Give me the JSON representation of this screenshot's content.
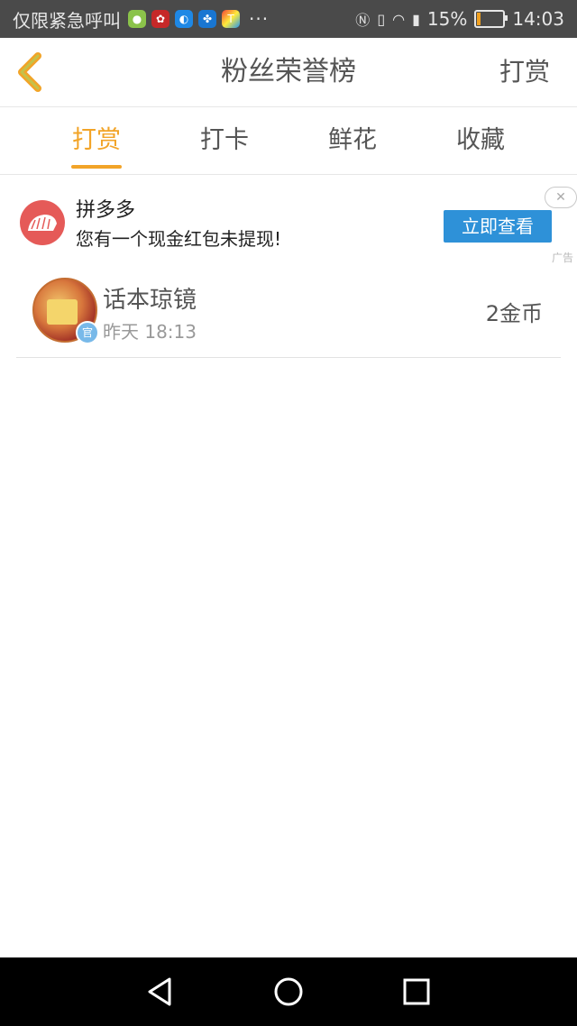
{
  "status_bar": {
    "carrier": "仅限紧急呼叫",
    "more": "···",
    "battery_percent": "15%",
    "time": "14:03",
    "notification_icons": [
      "wechat-icon",
      "huawei-icon",
      "app-blue-icon",
      "baidu-icon",
      "app-multicolor-icon"
    ]
  },
  "header": {
    "title": "粉丝荣誉榜",
    "action_label": "打赏"
  },
  "tabs": [
    {
      "label": "打赏",
      "active": true
    },
    {
      "label": "打卡",
      "active": false
    },
    {
      "label": "鲜花",
      "active": false
    },
    {
      "label": "收藏",
      "active": false
    }
  ],
  "ad": {
    "app_name": "拼多多",
    "description": "您有一个现金红包未提现!",
    "button_label": "立即查看",
    "ad_tag": "广告"
  },
  "rewards": [
    {
      "user_name": "话本琼镜",
      "time": "昨天 18:13",
      "amount": "2金币",
      "badge": "官"
    }
  ],
  "colors": {
    "accent": "#f2a428",
    "ad_button": "#2e91d8",
    "statusbar_bg": "#4a4a4a",
    "navbar_bg": "#000000"
  }
}
